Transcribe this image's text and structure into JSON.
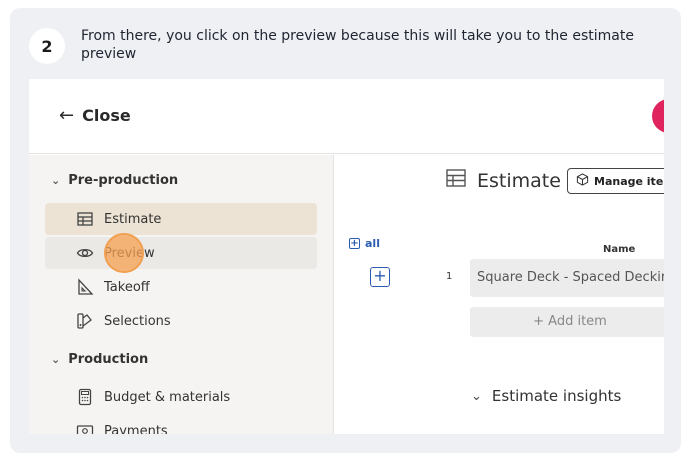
{
  "step": {
    "number": "2",
    "instruction": "From there, you click on the preview because this will take you to the estimate preview"
  },
  "topbar": {
    "back_arrow": "←",
    "close_label": "Close"
  },
  "sidebar": {
    "sections": [
      {
        "title": "Pre-production",
        "items": [
          {
            "label": "Estimate",
            "icon": "table-icon",
            "state": "active"
          },
          {
            "label": "Preview",
            "icon": "eye-icon",
            "state": "hover"
          },
          {
            "label": "Takeoff",
            "icon": "ruler-triangle-icon",
            "state": ""
          },
          {
            "label": "Selections",
            "icon": "swatches-icon",
            "state": ""
          }
        ]
      },
      {
        "title": "Production",
        "items": [
          {
            "label": "Budget & materials",
            "icon": "calculator-icon",
            "state": ""
          },
          {
            "label": "Payments",
            "icon": "cash-icon",
            "state": ""
          }
        ]
      }
    ]
  },
  "main": {
    "title": "Estimate",
    "manage_button": "Manage iten",
    "all_link": "all",
    "name_header": "Name",
    "rows": [
      {
        "index": "1",
        "name": "Square Deck - Spaced Deckir"
      }
    ],
    "add_item": "+ Add item",
    "insights": "Estimate insights"
  },
  "colors": {
    "card_bg": "#eef0f4",
    "sidebar_bg": "#f6f4f2",
    "active_item": "#ece3d5",
    "link_blue": "#2a5db0",
    "click_marker": "#f0a050",
    "avatar": "#e0245e"
  }
}
